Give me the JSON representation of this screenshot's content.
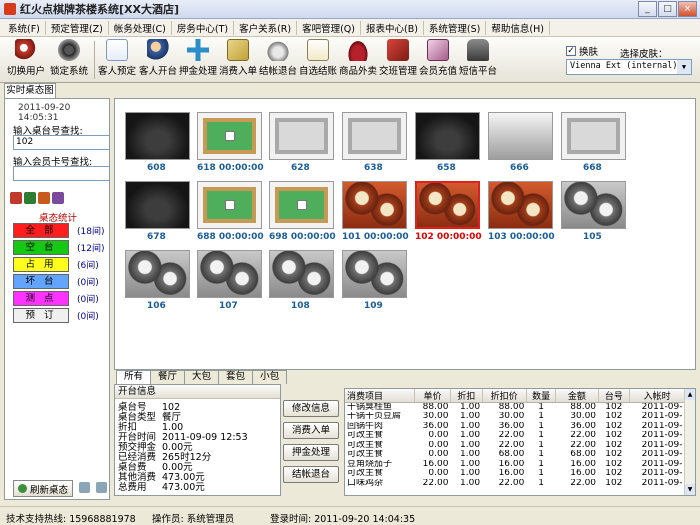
{
  "window": {
    "title": "红火点棋牌茶楼系统[XX大酒店]"
  },
  "menu": [
    "系统(F)",
    "预定管理(Z)",
    "帐务处理(C)",
    "房务中心(T)",
    "客户关系(R)",
    "客吧管理(Q)",
    "报表中心(B)",
    "系统管理(S)",
    "帮助信息(H)"
  ],
  "toolbar": {
    "items": [
      "切换用户",
      "锁定系统",
      "客人预定",
      "客人开台",
      "押金处理",
      "消费入单",
      "结帐退台",
      "自选结账",
      "商品外卖",
      "交班管理",
      "会员充值",
      "短信平台"
    ],
    "skin_checkbox": "换肤",
    "skin_label": "选择皮肤：",
    "skin_value": "Vienna Ext (internal)"
  },
  "left": {
    "tab": "实时桌态图",
    "datetime": "2011-09-20 14:05:31",
    "table_search_label": "输入桌台号查找:",
    "table_search_value": "102",
    "member_search_label": "输入会员卡号查找:",
    "member_search_value": "",
    "stats_title": "桌态统计",
    "stats": [
      {
        "label": "全 部",
        "count": "(18间)",
        "color": "#ff1d1d"
      },
      {
        "label": "空 台",
        "count": "(12间)",
        "color": "#14c814"
      },
      {
        "label": "占 用",
        "count": "(6间)",
        "color": "#ffff1e"
      },
      {
        "label": "坏 台",
        "count": "(0间)",
        "color": "#63a4ff"
      },
      {
        "label": "测 点",
        "count": "(0间)",
        "color": "#ff33ff"
      },
      {
        "label": "预 订",
        "count": "(0间)",
        "color": "#f0f0f0"
      }
    ],
    "refresh_label": "刷新桌态"
  },
  "tables": [
    {
      "label": "608",
      "kind": "dark",
      "red": false
    },
    {
      "label": "618  00:00:00",
      "kind": "green",
      "red": false
    },
    {
      "label": "628",
      "kind": "gray",
      "red": false
    },
    {
      "label": "638",
      "kind": "gray",
      "red": false
    },
    {
      "label": "658",
      "kind": "dark",
      "red": false
    },
    {
      "label": "666",
      "kind": "sofa",
      "red": false
    },
    {
      "label": "668",
      "kind": "gray",
      "red": false
    },
    {
      "label": "678",
      "kind": "dark",
      "red": false
    },
    {
      "label": "688  00:00:00",
      "kind": "green",
      "red": false
    },
    {
      "label": "698  00:00:00",
      "kind": "green",
      "red": false
    },
    {
      "label": "101  00:00:00",
      "kind": "tea",
      "red": false
    },
    {
      "label": "102  00:00:00",
      "kind": "tea",
      "red": true
    },
    {
      "label": "103  00:00:00",
      "kind": "tea",
      "red": false
    },
    {
      "label": "105",
      "kind": "teagray",
      "red": false
    },
    {
      "label": "106",
      "kind": "teagray",
      "red": false
    },
    {
      "label": "107",
      "kind": "teagray",
      "red": false
    },
    {
      "label": "108",
      "kind": "teagray",
      "red": false
    },
    {
      "label": "109",
      "kind": "teagray",
      "red": false
    }
  ],
  "bottom_tabs": [
    "所有",
    "餐厅",
    "大包",
    "套包",
    "小包"
  ],
  "table_info": {
    "header": "开台信息",
    "rows": [
      {
        "k": "桌台号",
        "v": "102"
      },
      {
        "k": "桌台类型",
        "v": "餐厅"
      },
      {
        "k": "折扣",
        "v": "1.00"
      },
      {
        "k": "开台时间",
        "v": "2011-09-09 12:53"
      },
      {
        "k": "预交押金",
        "v": "0.00元"
      },
      {
        "k": "已经消费",
        "v": "265时12分"
      },
      {
        "k": "桌台费",
        "v": "0.00元"
      },
      {
        "k": "其他消费",
        "v": "473.00元"
      },
      {
        "k": "总费用",
        "v": "473.00元"
      }
    ]
  },
  "actions": [
    "修改信息",
    "消费入单",
    "押金处理",
    "结帐退台"
  ],
  "orders": {
    "columns": [
      "消费项目",
      "单价",
      "折扣",
      "折扣价",
      "数量",
      "金额",
      "台号",
      "入帐时"
    ],
    "rows": [
      [
        "干锅臭桂鱼",
        "88.00",
        "1.00",
        "88.00",
        "1",
        "88.00",
        "102",
        "2011-09-"
      ],
      [
        "干锅干页豆腐",
        "30.00",
        "1.00",
        "30.00",
        "1",
        "30.00",
        "102",
        "2011-09-"
      ],
      [
        "回锅牛肉",
        "36.00",
        "1.00",
        "36.00",
        "1",
        "36.00",
        "102",
        "2011-09-"
      ],
      [
        "可改主食",
        "0.00",
        "1.00",
        "22.00",
        "1",
        "22.00",
        "102",
        "2011-09-"
      ],
      [
        "可改主食",
        "0.00",
        "1.00",
        "22.00",
        "1",
        "22.00",
        "102",
        "2011-09-"
      ],
      [
        "可改主食",
        "0.00",
        "1.00",
        "68.00",
        "1",
        "68.00",
        "102",
        "2011-09-"
      ],
      [
        "豆角烧茄子",
        "16.00",
        "1.00",
        "16.00",
        "1",
        "16.00",
        "102",
        "2011-09-"
      ],
      [
        "可改主食",
        "0.00",
        "1.00",
        "16.00",
        "1",
        "16.00",
        "102",
        "2011-09-"
      ],
      [
        "口味鸡杂",
        "22.00",
        "1.00",
        "22.00",
        "1",
        "22.00",
        "102",
        "2011-09-"
      ]
    ]
  },
  "status": {
    "hotline": "技术支持热线: 15968881978",
    "operator": "操作员:  系统管理员",
    "login": "登录时间: 2011-09-20 14:04:35"
  }
}
